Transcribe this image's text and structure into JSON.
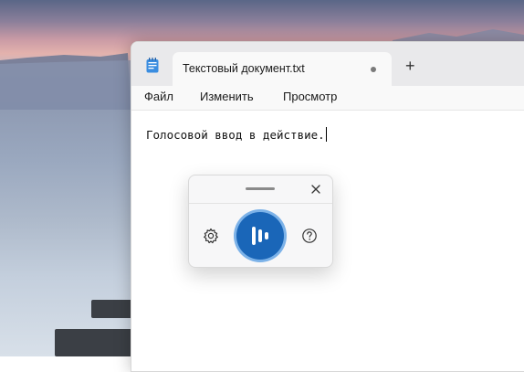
{
  "notepad": {
    "tab_title": "Текстовый документ.txt",
    "new_tab_label": "+",
    "menu": {
      "file": "Файл",
      "edit": "Изменить",
      "view": "Просмотр"
    },
    "document_text": "Голосовой ввод в действие."
  },
  "voice_typing": {
    "close_label": "✕",
    "icons": {
      "settings": "gear-icon",
      "microphone": "voice-bars-icon",
      "help": "question-circle-icon"
    },
    "state": "listening"
  },
  "colors": {
    "accent": "#1a66b8",
    "accent_ring": "#7cb2e8"
  }
}
